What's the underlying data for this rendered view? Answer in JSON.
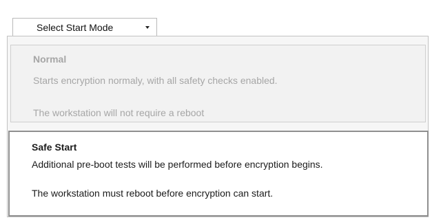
{
  "select": {
    "label": "Select Start Mode",
    "caret_icon": "caret-down-icon"
  },
  "options": [
    {
      "title": "Normal",
      "line1": "Starts encryption normaly, with all safety checks enabled.",
      "line2": "The workstation will not require a reboot",
      "state": "disabled"
    },
    {
      "title": "Safe Start",
      "line1": "Additional pre-boot tests will be performed before encryption begins.",
      "line2": "The workstation must reboot before encryption can start.",
      "state": "selected"
    }
  ],
  "colors": {
    "disabled_text": "#a6a6a6",
    "active_text": "#1b1b1b",
    "selected_border": "#8f8f8f"
  }
}
